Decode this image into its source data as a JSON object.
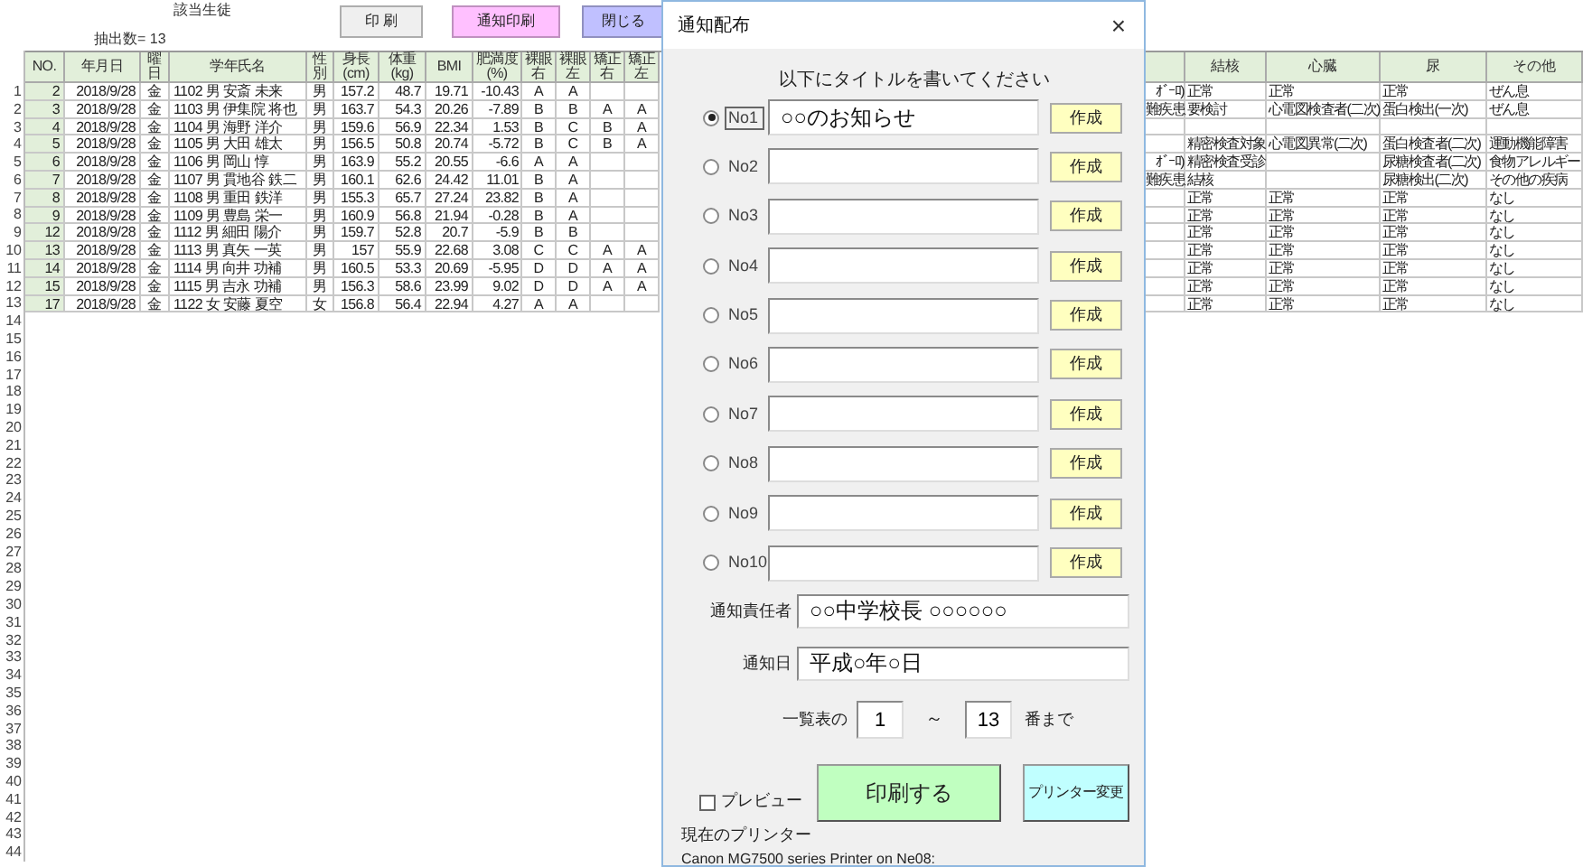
{
  "sheet": {
    "title": "該当生徒",
    "count_label": "抽出数= 13",
    "buttons": [
      {
        "label": "印 刷",
        "kind": "gray"
      },
      {
        "label": "通知印刷",
        "kind": "pink"
      },
      {
        "label": "閉じる",
        "kind": "purple"
      }
    ],
    "columns": [
      "NO.",
      "年月日",
      "曜日",
      "学年氏名",
      "性別",
      "身長\n(cm)",
      "体重\n(kg)",
      "BMI",
      "肥満度\n(%)",
      "裸眼右",
      "裸眼左",
      "矯正右",
      "矯正左"
    ],
    "right_columns": [
      "",
      "結核",
      "心臓",
      "尿",
      "その他"
    ],
    "rows": [
      {
        "row_number": "1",
        "cells": [
          "2",
          "2018/9/28",
          "金",
          "1102 男 安斎 未来",
          "男",
          "157.2",
          "48.7",
          "19.71",
          "-10.43",
          "A",
          "A",
          "",
          ""
        ],
        "right_cells": [
          "ｵﾞｰﾛ)",
          "正常",
          "正常",
          "正常",
          "ぜん息"
        ]
      },
      {
        "row_number": "2",
        "cells": [
          "3",
          "2018/9/28",
          "金",
          "1103 男 伊集院 将也",
          "男",
          "163.7",
          "54.3",
          "20.26",
          "-7.89",
          "B",
          "B",
          "A",
          "A"
        ],
        "right_cells": [
          "難疾患",
          "要検討",
          "心電図検査者(二次)",
          "蛋白検出(一次)",
          "ぜん息"
        ]
      },
      {
        "row_number": "3",
        "cells": [
          "4",
          "2018/9/28",
          "金",
          "1104 男 海野 洋介",
          "男",
          "159.6",
          "56.9",
          "22.34",
          "1.53",
          "B",
          "C",
          "B",
          "A"
        ],
        "right_cells": [
          "",
          "",
          "",
          "",
          ""
        ]
      },
      {
        "row_number": "4",
        "cells": [
          "5",
          "2018/9/28",
          "金",
          "1105 男 大田 雄太",
          "男",
          "156.5",
          "50.8",
          "20.74",
          "-5.72",
          "B",
          "C",
          "B",
          "A"
        ],
        "right_cells": [
          "",
          "精密検査対象",
          "心電図異常(二次)",
          "蛋白検査者(二次)",
          "運動機能障害"
        ]
      },
      {
        "row_number": "5",
        "cells": [
          "6",
          "2018/9/28",
          "金",
          "1106 男 岡山 惇",
          "男",
          "163.9",
          "55.2",
          "20.55",
          "-6.6",
          "A",
          "A",
          "",
          ""
        ],
        "right_cells": [
          "ｵﾞｰﾛ)",
          "精密検査受診",
          "",
          "尿糖検査者(二次)",
          "食物アレルギー"
        ]
      },
      {
        "row_number": "6",
        "cells": [
          "7",
          "2018/9/28",
          "金",
          "1107 男 貫地谷 鉄二",
          "男",
          "160.1",
          "62.6",
          "24.42",
          "11.01",
          "B",
          "A",
          "",
          ""
        ],
        "right_cells": [
          "難疾患",
          "結核",
          "",
          "尿糖検出(二次)",
          "その他の疾病"
        ]
      },
      {
        "row_number": "7",
        "cells": [
          "8",
          "2018/9/28",
          "金",
          "1108 男 重田 鉄洋",
          "男",
          "155.3",
          "65.7",
          "27.24",
          "23.82",
          "B",
          "A",
          "",
          ""
        ],
        "right_cells": [
          "",
          "正常",
          "正常",
          "正常",
          "なし"
        ]
      },
      {
        "row_number": "8",
        "cells": [
          "9",
          "2018/9/28",
          "金",
          "1109 男 豊島 栄一",
          "男",
          "160.9",
          "56.8",
          "21.94",
          "-0.28",
          "B",
          "A",
          "",
          ""
        ],
        "right_cells": [
          "",
          "正常",
          "正常",
          "正常",
          "なし"
        ]
      },
      {
        "row_number": "9",
        "cells": [
          "12",
          "2018/9/28",
          "金",
          "1112 男 細田 陽介",
          "男",
          "159.7",
          "52.8",
          "20.7",
          "-5.9",
          "B",
          "B",
          "",
          ""
        ],
        "right_cells": [
          "",
          "正常",
          "正常",
          "正常",
          "なし"
        ]
      },
      {
        "row_number": "10",
        "cells": [
          "13",
          "2018/9/28",
          "金",
          "1113 男 真矢 一英",
          "男",
          "157",
          "55.9",
          "22.68",
          "3.08",
          "C",
          "C",
          "A",
          "A"
        ],
        "right_cells": [
          "",
          "正常",
          "正常",
          "正常",
          "なし"
        ]
      },
      {
        "row_number": "11",
        "cells": [
          "14",
          "2018/9/28",
          "金",
          "1114 男 向井 功補",
          "男",
          "160.5",
          "53.3",
          "20.69",
          "-5.95",
          "D",
          "D",
          "A",
          "A"
        ],
        "right_cells": [
          "",
          "正常",
          "正常",
          "正常",
          "なし"
        ]
      },
      {
        "row_number": "12",
        "cells": [
          "15",
          "2018/9/28",
          "金",
          "1115 男 吉永 功補",
          "男",
          "156.3",
          "58.6",
          "23.99",
          "9.02",
          "D",
          "D",
          "A",
          "A"
        ],
        "right_cells": [
          "",
          "正常",
          "正常",
          "正常",
          "なし"
        ]
      },
      {
        "row_number": "13",
        "cells": [
          "17",
          "2018/9/28",
          "金",
          "1122 女 安藤 夏空",
          "女",
          "156.8",
          "56.4",
          "22.94",
          "4.27",
          "A",
          "A",
          "",
          ""
        ],
        "right_cells": [
          "",
          "正常",
          "正常",
          "正常",
          "なし"
        ]
      },
      {
        "row_number": "14"
      },
      {
        "row_number": "15"
      },
      {
        "row_number": "16"
      },
      {
        "row_number": "17"
      },
      {
        "row_number": "18"
      },
      {
        "row_number": "19"
      },
      {
        "row_number": "20"
      },
      {
        "row_number": "21"
      },
      {
        "row_number": "22"
      },
      {
        "row_number": "23"
      },
      {
        "row_number": "24"
      },
      {
        "row_number": "25"
      },
      {
        "row_number": "26"
      },
      {
        "row_number": "27"
      },
      {
        "row_number": "28"
      },
      {
        "row_number": "29"
      },
      {
        "row_number": "30"
      },
      {
        "row_number": "31"
      },
      {
        "row_number": "32"
      },
      {
        "row_number": "33"
      },
      {
        "row_number": "34"
      },
      {
        "row_number": "35"
      },
      {
        "row_number": "36"
      },
      {
        "row_number": "37"
      },
      {
        "row_number": "38"
      },
      {
        "row_number": "39"
      },
      {
        "row_number": "40"
      },
      {
        "row_number": "41"
      },
      {
        "row_number": "42"
      },
      {
        "row_number": "43"
      },
      {
        "row_number": "44"
      }
    ]
  },
  "dialog": {
    "title": "通知配布",
    "close": "×",
    "instruction": "以下にタイトルを書いてください",
    "notices": [
      {
        "label": "No1",
        "selected": true,
        "value": "○○のお知らせ",
        "button": "作成"
      },
      {
        "label": "No2",
        "selected": false,
        "button": "作成"
      },
      {
        "label": "No3",
        "selected": false,
        "button": "作成"
      },
      {
        "label": "No4",
        "selected": false,
        "button": "作成"
      },
      {
        "label": "No5",
        "selected": false,
        "button": "作成"
      },
      {
        "label": "No6",
        "selected": false,
        "button": "作成"
      },
      {
        "label": "No7",
        "selected": false,
        "button": "作成"
      },
      {
        "label": "No8",
        "selected": false,
        "button": "作成"
      },
      {
        "label": "No9",
        "selected": false,
        "button": "作成"
      },
      {
        "label": "No10",
        "selected": false,
        "button": "作成"
      }
    ],
    "fields": [
      {
        "label": "通知責任者",
        "value": "○○中学校長 ○○○○○○"
      },
      {
        "label": "通知日",
        "value": "平成○年○日"
      }
    ],
    "range": {
      "prefix": "一覧表の",
      "from": "1",
      "separator": "～",
      "to": "13",
      "suffix": "番まで"
    },
    "preview": {
      "label": "プレビュー",
      "checked": false
    },
    "print_button": "印刷する",
    "printer_button": "プリンター変更",
    "printer_label": "現在のプリンター",
    "printer_name": "Canon MG7500 series Printer on Ne08:"
  }
}
